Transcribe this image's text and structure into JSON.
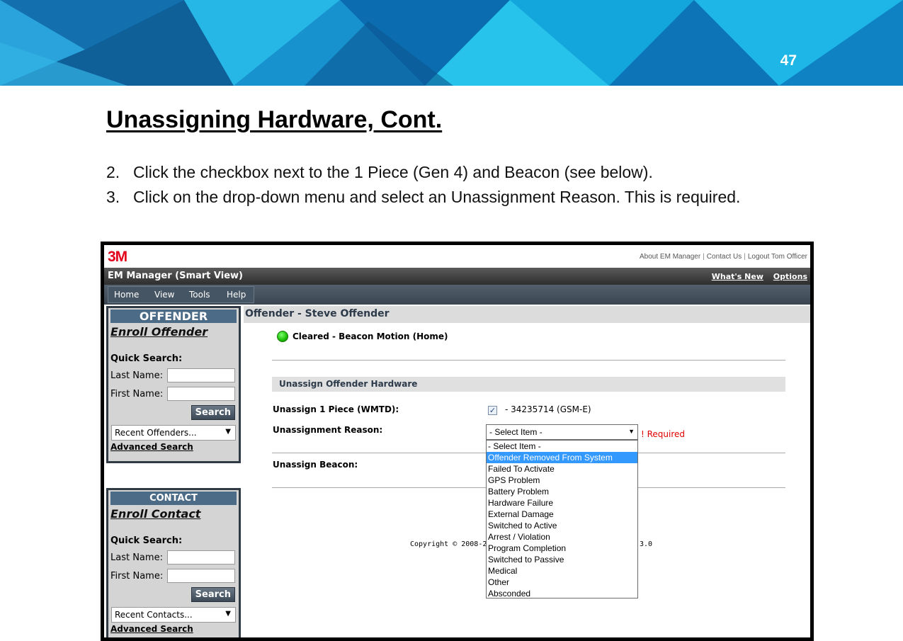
{
  "slide": {
    "page_number": "47",
    "title": "Unassigning Hardware, Cont.",
    "steps": [
      {
        "num": "2.",
        "text": "Click the checkbox next to the 1 Piece (Gen 4) and Beacon (see below)."
      },
      {
        "num": "3.",
        "text": "Click on the drop-down menu and select an Unassignment Reason. This is required."
      }
    ]
  },
  "app": {
    "logo": "3M",
    "top_links": [
      "About EM Manager",
      "Contact Us",
      "Logout Tom Officer"
    ],
    "top_link_sep": "|",
    "title": "EM Manager (Smart View)",
    "header_links": [
      "What's New",
      "Options"
    ],
    "menu": [
      "Home",
      "View",
      "Tools",
      "Help"
    ]
  },
  "offender_panel": {
    "header": "OFFENDER",
    "enroll": "Enroll Offender",
    "quick_search": "Quick Search:",
    "last_name_label": "Last Name:",
    "first_name_label": "First Name:",
    "search_button": "Search",
    "recent": "Recent Offenders...",
    "advanced": "Advanced Search"
  },
  "contact_panel": {
    "header": "CONTACT",
    "enroll": "Enroll Contact",
    "quick_search": "Quick Search:",
    "last_name_label": "Last Name:",
    "first_name_label": "First Name:",
    "search_button": "Search",
    "recent": "Recent Contacts...",
    "advanced": "Advanced Search"
  },
  "main": {
    "heading": "Offender - Steve Offender",
    "status": "Cleared - Beacon Motion (Home)",
    "status_color": "#1cbd06",
    "section": "Unassign Offender Hardware",
    "unassign_label": "Unassign 1 Piece (WMTD):",
    "device": "- 34235714 (GSM-E)",
    "checkbox_checked": true,
    "reason_label": "Unassignment Reason:",
    "select_value": "- Select Item -",
    "required": "! Required",
    "beacon_label": "Unassign Beacon:",
    "options": [
      "- Select Item -",
      "Offender Removed From System",
      "Failed To Activate",
      "GPS Problem",
      "Battery Problem",
      "Hardware Failure",
      "External Damage",
      "Switched to Active",
      "Arrest / Violation",
      "Program Completion",
      "Switched to Passive",
      "Medical",
      "Other",
      "Absconded"
    ],
    "highlighted_option": "Offender Removed From System",
    "copyright": "Copyright © 2008-2",
    "copyright_tail": "3.0"
  }
}
